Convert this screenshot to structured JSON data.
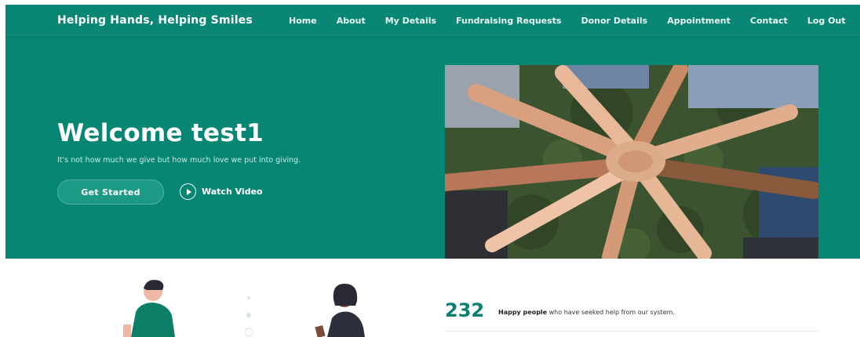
{
  "navbar": {
    "brand": "Helping Hands, Helping Smiles",
    "links": [
      "Home",
      "About",
      "My Details",
      "Fundraising Requests",
      "Donor Details",
      "Appointment",
      "Contact",
      "Log Out"
    ]
  },
  "hero": {
    "title": "Welcome test1",
    "subtitle": "It's not how much we give but how much love we put into giving.",
    "primary_button": "Get Started",
    "secondary_button": "Watch Video",
    "secondary_icon": "play-circle-icon"
  },
  "stats": {
    "number": "232",
    "bold_text": "Happy people",
    "text": " who have seeked help from our system."
  },
  "colors": {
    "primary": "#088674",
    "accent_text": "#0a7f6e"
  }
}
